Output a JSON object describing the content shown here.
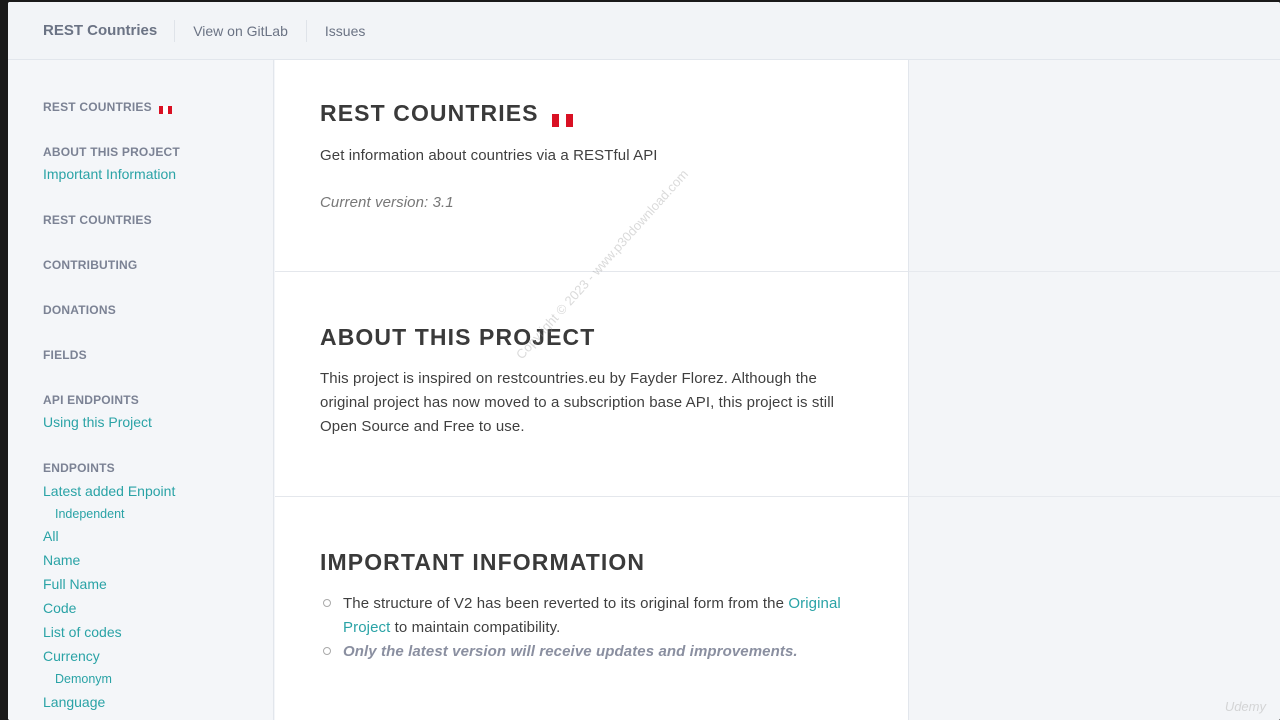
{
  "topbar": {
    "brand": "REST Countries",
    "links": [
      "View on GitLab",
      "Issues"
    ]
  },
  "sidebar": {
    "groups": [
      {
        "heading": "REST COUNTRIES",
        "has_flag": true,
        "items": []
      },
      {
        "heading": "ABOUT THIS PROJECT",
        "items": [
          "Important Information"
        ]
      },
      {
        "heading": "REST COUNTRIES",
        "items": []
      },
      {
        "heading": "CONTRIBUTING",
        "items": []
      },
      {
        "heading": "DONATIONS",
        "items": []
      },
      {
        "heading": "FIELDS",
        "items": []
      },
      {
        "heading": "API ENDPOINTS",
        "items": [
          "Using this Project"
        ]
      },
      {
        "heading": "ENDPOINTS",
        "items": [
          "Latest added Enpoint",
          "Independent",
          "All",
          "Name",
          "Full Name",
          "Code",
          "List of codes",
          "Currency",
          "Demonym",
          "Language"
        ]
      }
    ]
  },
  "main": {
    "intro": {
      "title": "REST COUNTRIES",
      "description": "Get information about countries via a RESTful API",
      "version": "Current version: 3.1"
    },
    "about": {
      "title": "ABOUT THIS PROJECT",
      "text": "This project is inspired on restcountries.eu by Fayder Florez. Although the original project has now moved to a subscription base API, this project is still Open Source and Free to use."
    },
    "important": {
      "title": "IMPORTANT INFORMATION",
      "bullet1_before": "The structure of V2 has been reverted to its original form from the",
      "bullet1_link": "Original Project",
      "bullet1_after": " to maintain compatibility.",
      "bullet2": "Only the latest version will receive updates and improvements."
    }
  },
  "overlay": {
    "watermark": "Copyright © 2023 - www.p30download.com",
    "udemy": "Udemy"
  },
  "colors": {
    "accent": "#2aa3a6",
    "flag_red": "#d91023",
    "flag_white": "#ffffff"
  }
}
